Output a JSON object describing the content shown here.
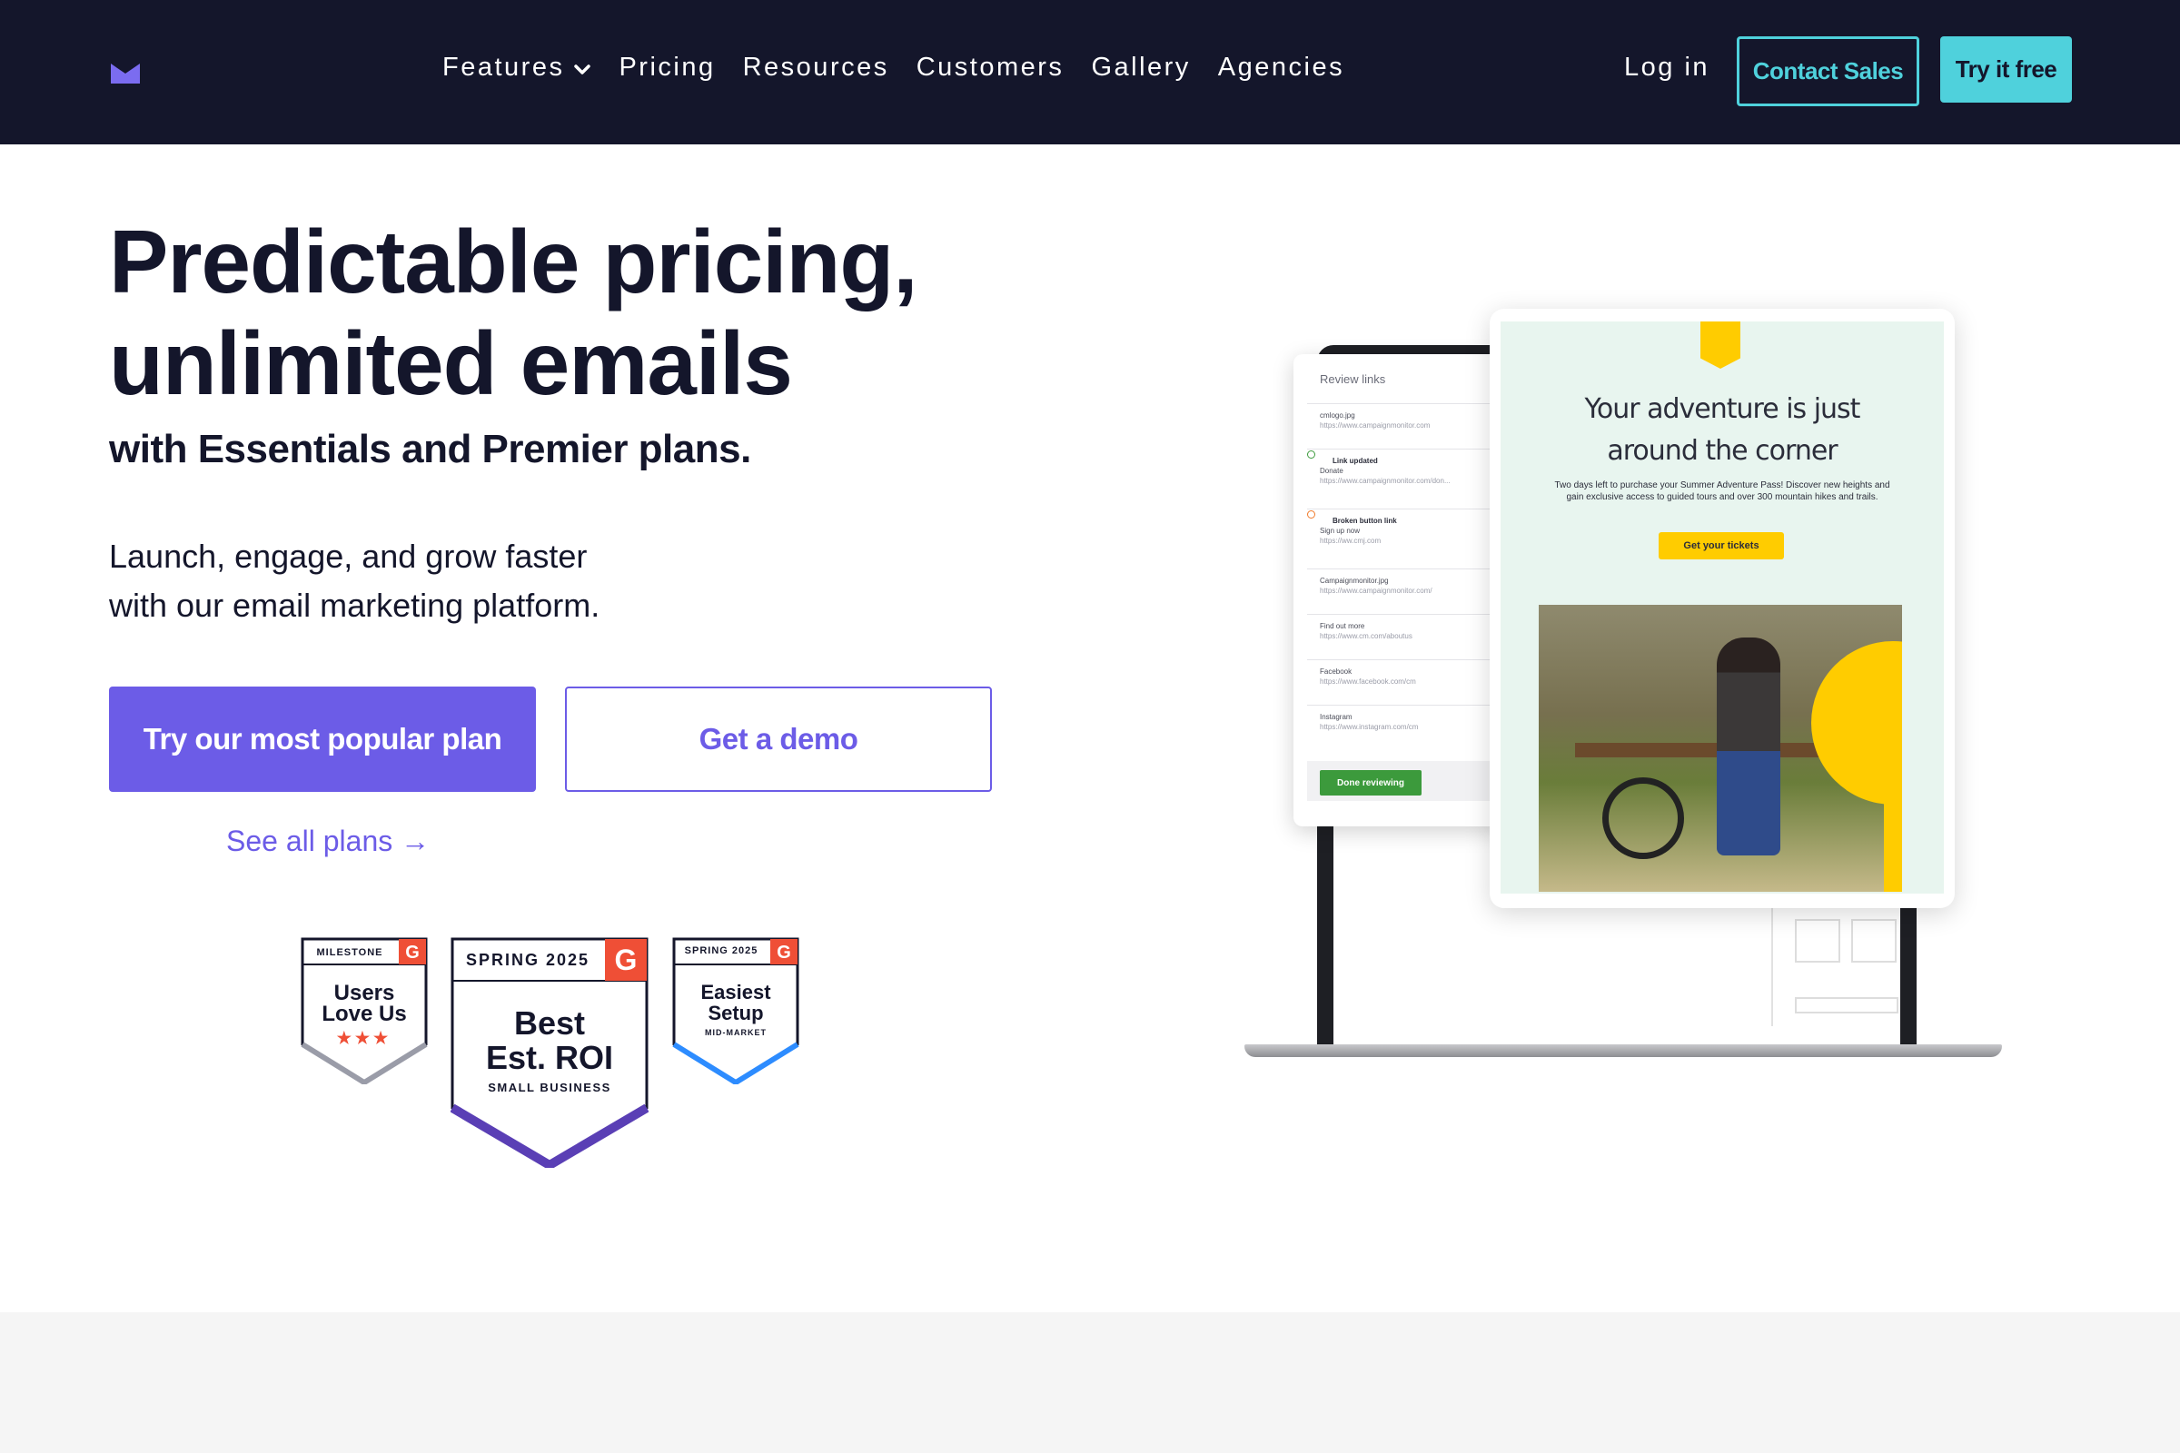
{
  "nav": {
    "logo": "logo-icon",
    "links": [
      {
        "label": "Features",
        "has_dropdown": true
      },
      {
        "label": "Pricing"
      },
      {
        "label": "Resources"
      },
      {
        "label": "Customers"
      },
      {
        "label": "Gallery"
      },
      {
        "label": "Agencies"
      }
    ],
    "login": "Log in",
    "contact_sales": "Contact Sales",
    "try_free": "Try it free"
  },
  "hero": {
    "title_line1": "Predictable pricing,",
    "title_line2": "unlimited emails",
    "subtitle": "with Essentials and Premier plans.",
    "lead_line1": "Launch, engage, and grow faster",
    "lead_line2": "with our email marketing platform.",
    "cta_primary": "Try our most popular plan",
    "cta_secondary": "Get a demo",
    "see_all": "See all plans →"
  },
  "badges": [
    {
      "top": "MILESTONE",
      "line1": "Users",
      "line2": "Love Us",
      "stars": "★★★"
    },
    {
      "top": "SPRING 2025",
      "line1": "Best",
      "line2": "Est. ROI",
      "sub": "SMALL BUSINESS"
    },
    {
      "top": "SPRING 2025",
      "line1": "Easiest",
      "line2": "Setup",
      "sub": "MID-MARKET"
    }
  ],
  "mockup": {
    "review_title": "Review links",
    "review_items": [
      {
        "name": "cmlogo.jpg",
        "url": "https://www.campaignmonitor.com"
      },
      {
        "status": "Link updated",
        "name": "Donate",
        "url": "https://www.campaignmonitor.com/don..."
      },
      {
        "status": "Broken button link",
        "name": "Sign up now",
        "url": "https://ww.cmj.com"
      },
      {
        "name": "Campaignmonitor.jpg",
        "url": "https://www.campaignmonitor.com/"
      },
      {
        "name": "Find out more",
        "url": "https://www.cm.com/aboutus"
      },
      {
        "name": "Facebook",
        "url": "https://www.facebook.com/cm"
      },
      {
        "name": "Instagram",
        "url": "https://www.instagram.com/cm"
      }
    ],
    "done_button": "Done reviewing",
    "email_title_line1": "Your adventure is just",
    "email_title_line2": "around the corner",
    "email_body": "Two days left to purchase your Summer Adventure Pass! Discover new heights and gain exclusive access to guided tours and over 300 mountain hikes and trails.",
    "email_cta": "Get your tickets"
  },
  "colors": {
    "nav_bg": "#14162b",
    "accent_purple": "#6c5ce7",
    "accent_teal": "#4fd1dc",
    "text_dark": "#14162b",
    "g2_red": "#ef4f36",
    "email_yellow": "#ffcc00"
  }
}
